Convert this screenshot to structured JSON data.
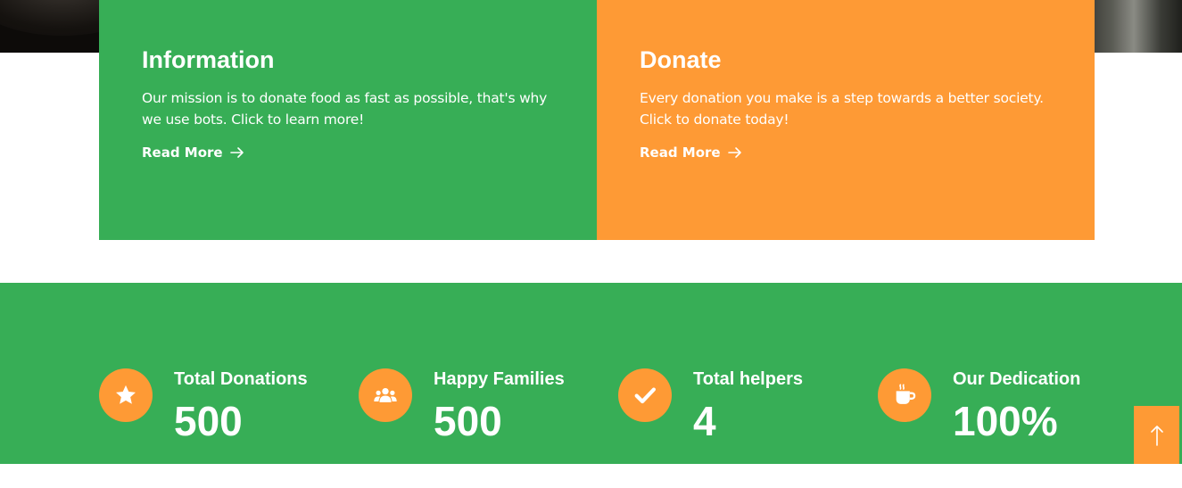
{
  "info_card": {
    "title": "Information",
    "text": "Our mission is to donate food as fast as possible, that's why we use bots. Click to learn more!",
    "link_label": "Read More"
  },
  "donate_card": {
    "title": "Donate",
    "text": "Every donation you make is a step towards a better society. Click to donate today!",
    "link_label": "Read More"
  },
  "stats": [
    {
      "icon": "star-icon",
      "label": "Total Donations",
      "value": "500"
    },
    {
      "icon": "users-icon",
      "label": "Happy Families",
      "value": "500"
    },
    {
      "icon": "check-icon",
      "label": "Total helpers",
      "value": "4"
    },
    {
      "icon": "coffee-icon",
      "label": "Our Dedication",
      "value": "100%"
    }
  ],
  "colors": {
    "green": "#37ae56",
    "orange": "#fe9a35",
    "text": "#ffffff"
  },
  "back_to_top_icon": "arrow-up-icon"
}
